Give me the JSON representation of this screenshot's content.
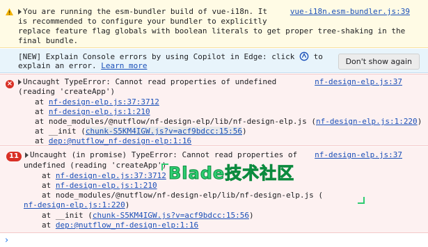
{
  "warning": {
    "lines": [
      "You are running the esm-bundler build of vue-i18n. It",
      "is recommended to configure your bundler to explicitly",
      "replace feature flag globals with boolean literals to get proper tree-shaking in the",
      "final bundle."
    ],
    "source": "vue-i18n.esm-bundler.js:39"
  },
  "info": {
    "line1_before": "[NEW] Explain Console errors by using Copilot in Edge: click",
    "line1_after": "to",
    "line2_before": "explain an error.",
    "learn_more": "Learn more",
    "dismiss_button": "Don't show again"
  },
  "error1": {
    "title_line1": "Uncaught TypeError: Cannot read properties of undefined",
    "title_line2": "(reading 'createApp')",
    "source": "nf-design-elp.js:37",
    "stack": [
      {
        "prefix": "at ",
        "link": "nf-design-elp.js:37:3712",
        "suffix": ""
      },
      {
        "prefix": "at ",
        "link": "nf-design-elp.js:1:210",
        "suffix": ""
      },
      {
        "prefix": "at node_modules/@nutflow/nf-design-elp/lib/nf-design-elp.js (",
        "link": "nf-design-elp.js:1:220",
        "suffix": ")"
      },
      {
        "prefix": "at __init (",
        "link": "chunk-S5KM4IGW.js?v=acf9bdcc:15:56",
        "suffix": ")"
      },
      {
        "prefix": "at ",
        "link": "dep:@nutflow_nf-design-elp:1:16",
        "suffix": ""
      }
    ]
  },
  "error2": {
    "count": "11",
    "title_line1": "Uncaught (in promise) TypeError: Cannot read properties of",
    "title_line2": "undefined (reading 'createApp')",
    "source": "nf-design-elp.js:37",
    "stack": [
      {
        "prefix": "at ",
        "link": "nf-design-elp.js:37:3712",
        "suffix": ""
      },
      {
        "prefix": "at ",
        "link": "nf-design-elp.js:1:210",
        "suffix": ""
      },
      {
        "prefix": "at node_modules/@nutflow/nf-design-elp/lib/nf-design-elp.js (",
        "link": "",
        "suffix": ""
      },
      {
        "prefix": "",
        "link": "nf-design-elp.js:1:220",
        "suffix": ")"
      },
      {
        "prefix": "at __init (",
        "link": "chunk-S5KM4IGW.js?v=acf9bdcc:15:56",
        "suffix": ")"
      },
      {
        "prefix": "at ",
        "link": "dep:@nutflow_nf-design-elp:1:16",
        "suffix": ""
      }
    ]
  },
  "watermark": "Blade技术社区",
  "prompt_symbol": "›",
  "colors": {
    "error": "#d93025",
    "link": "#1a4fb8",
    "warning_bg": "#fffbe5",
    "info_bg": "#e8f4fb",
    "error_bg": "#fdf1f1"
  }
}
